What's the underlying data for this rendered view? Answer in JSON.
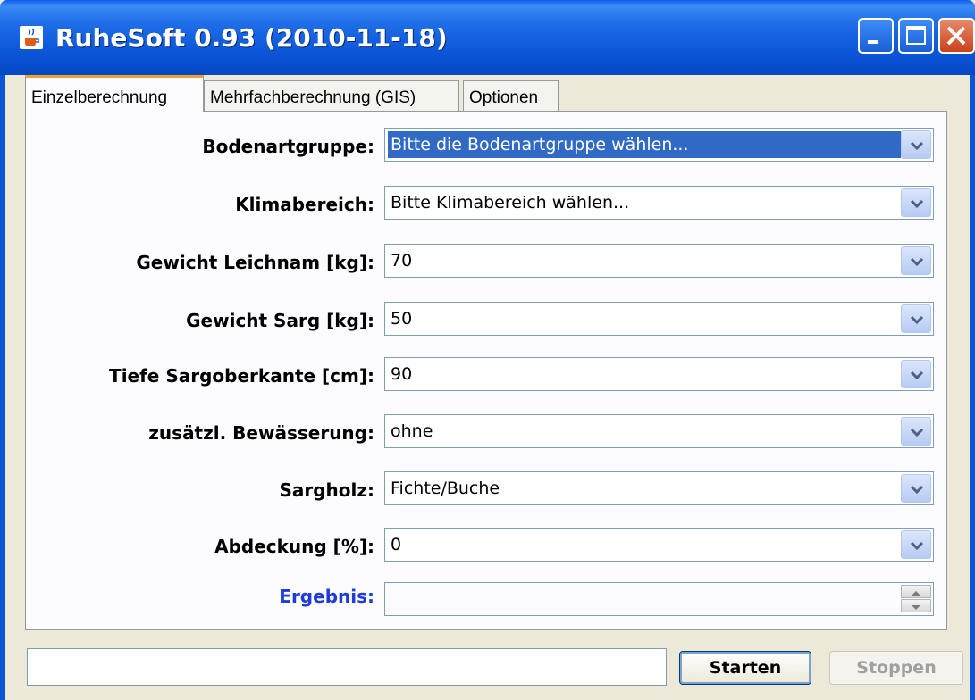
{
  "window": {
    "title": "RuheSoft 0.93 (2010-11-18)",
    "icon": "java-cup-icon",
    "controls": [
      "minimize-icon",
      "maximize-icon",
      "close-icon"
    ]
  },
  "tabs": [
    {
      "label": "Einzelberechnung",
      "active": true
    },
    {
      "label": "Mehrfachberechnung (GIS)",
      "active": false
    },
    {
      "label": "Optionen",
      "active": false
    }
  ],
  "form": {
    "bodenartgruppe": {
      "label": "Bodenartgruppe:",
      "value": "Bitte die Bodenartgruppe wählen..."
    },
    "klimabereich": {
      "label": "Klimabereich:",
      "value": "Bitte Klimabereich wählen..."
    },
    "gewicht_leichnam": {
      "label": "Gewicht Leichnam [kg]:",
      "value": "70"
    },
    "gewicht_sarg": {
      "label": "Gewicht Sarg [kg]:",
      "value": "50"
    },
    "tiefe": {
      "label": "Tiefe Sargoberkante [cm]:",
      "value": "90"
    },
    "bewaesserung": {
      "label": "zusätzl. Bewässerung:",
      "value": "ohne"
    },
    "sargholz": {
      "label": "Sargholz:",
      "value": "Fichte/Buche"
    },
    "abdeckung": {
      "label": "Abdeckung [%]:",
      "value": "0"
    },
    "ergebnis": {
      "label": "Ergebnis:",
      "value": ""
    }
  },
  "buttons": {
    "start": "Starten",
    "stop": "Stoppen"
  },
  "status": {
    "text": ""
  },
  "colors": {
    "titlebar": "#0b56d8",
    "selection": "#316ac5",
    "ergebnis_label": "#1f3bd8",
    "tab_accent": "#f0a030"
  }
}
